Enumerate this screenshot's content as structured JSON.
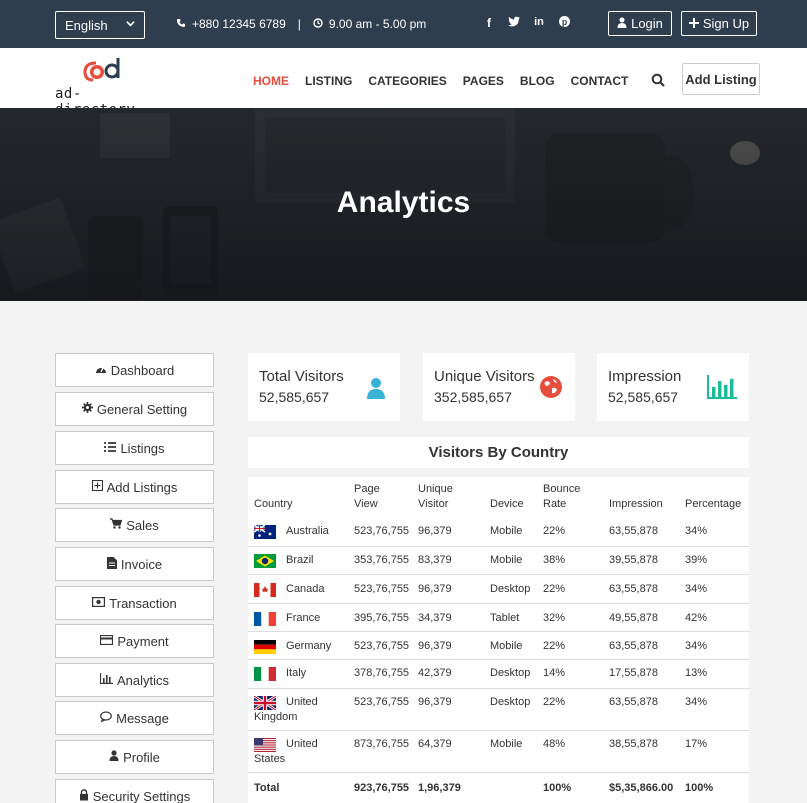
{
  "topbar": {
    "language": "English",
    "phone": "+880 12345 6789",
    "separator": "|",
    "hours": "9.00 am - 5.00 pm",
    "social_icons": [
      "facebook-icon",
      "twitter-icon",
      "linkedin-icon",
      "pinterest-icon"
    ],
    "login_label": "Login",
    "signup_label": "Sign Up"
  },
  "navbar": {
    "logo_text": "ad-directory",
    "items": [
      "HOME",
      "LISTING",
      "CATEGORIES",
      "PAGES",
      "BLOG",
      "CONTACT"
    ],
    "active_item": "HOME",
    "add_listing_label": "Add Listing"
  },
  "hero": {
    "title": "Analytics"
  },
  "sidebar": {
    "items": [
      {
        "label": "Dashboard",
        "icon": "dashboard-icon"
      },
      {
        "label": "General Setting",
        "icon": "gear-icon"
      },
      {
        "label": "Listings",
        "icon": "list-icon"
      },
      {
        "label": "Add Listings",
        "icon": "plus-square-icon"
      },
      {
        "label": "Sales",
        "icon": "cart-icon"
      },
      {
        "label": "Invoice",
        "icon": "file-icon"
      },
      {
        "label": "Transaction",
        "icon": "money-icon"
      },
      {
        "label": "Payment",
        "icon": "credit-card-icon"
      },
      {
        "label": "Analytics",
        "icon": "bar-chart-icon"
      },
      {
        "label": "Message",
        "icon": "chat-icon"
      },
      {
        "label": "Profile",
        "icon": "user-icon"
      },
      {
        "label": "Security Settings",
        "icon": "lock-icon"
      }
    ]
  },
  "stats": [
    {
      "label": "Total Visitors",
      "value": "52,585,657",
      "icon": "user-icon",
      "color": "#36b3d6"
    },
    {
      "label": "Unique Visitors",
      "value": "352,585,657",
      "icon": "globe-icon",
      "color": "#e74c3c"
    },
    {
      "label": "Impression",
      "value": "52,585,657",
      "icon": "bar-chart-icon",
      "color": "#1abc9c"
    }
  ],
  "table": {
    "title": "Visitors By Country",
    "headers": {
      "country": "Country",
      "page_view": "Page View",
      "unique_visitor": "Unique Visitor",
      "device": "Device",
      "bounce_rate": "Bounce Rate",
      "impression": "Impression",
      "percentage": "Percentage"
    },
    "rows": [
      {
        "country": "Australia",
        "flag": "australia-flag-icon",
        "page_view": "523,76,755",
        "unique_visitor": "96,379",
        "device": "Mobile",
        "bounce_rate": "22%",
        "impression": "63,55,878",
        "percentage": "34%"
      },
      {
        "country": "Brazil",
        "flag": "brazil-flag-icon",
        "page_view": "353,76,755",
        "unique_visitor": "83,379",
        "device": "Mobile",
        "bounce_rate": "38%",
        "impression": "39,55,878",
        "percentage": "39%"
      },
      {
        "country": "Canada",
        "flag": "canada-flag-icon",
        "page_view": "523,76,755",
        "unique_visitor": "96,379",
        "device": "Desktop",
        "bounce_rate": "22%",
        "impression": "63,55,878",
        "percentage": "34%"
      },
      {
        "country": "France",
        "flag": "france-flag-icon",
        "page_view": "395,76,755",
        "unique_visitor": "34,379",
        "device": "Tablet",
        "bounce_rate": "32%",
        "impression": "49,55,878",
        "percentage": "42%"
      },
      {
        "country": "Germany",
        "flag": "germany-flag-icon",
        "page_view": "523,76,755",
        "unique_visitor": "96,379",
        "device": "Mobile",
        "bounce_rate": "22%",
        "impression": "63,55,878",
        "percentage": "34%"
      },
      {
        "country": "Italy",
        "flag": "italy-flag-icon",
        "page_view": "378,76,755",
        "unique_visitor": "42,379",
        "device": "Desktop",
        "bounce_rate": "14%",
        "impression": "17,55,878",
        "percentage": "13%"
      },
      {
        "country": "United Kingdom",
        "flag": "uk-flag-icon",
        "page_view": "523,76,755",
        "unique_visitor": "96,379",
        "device": "Desktop",
        "bounce_rate": "22%",
        "impression": "63,55,878",
        "percentage": "34%"
      },
      {
        "country": "United States",
        "flag": "usa-flag-icon",
        "page_view": "873,76,755",
        "unique_visitor": "64,379",
        "device": "Mobile",
        "bounce_rate": "48%",
        "impression": "38,55,878",
        "percentage": "17%"
      }
    ],
    "total": {
      "label": "Total",
      "page_view": "923,76,755",
      "unique_visitor": "1,96,379",
      "bounce_rate": "100%",
      "impression": "$5,35,866.00",
      "percentage": "100%"
    }
  }
}
